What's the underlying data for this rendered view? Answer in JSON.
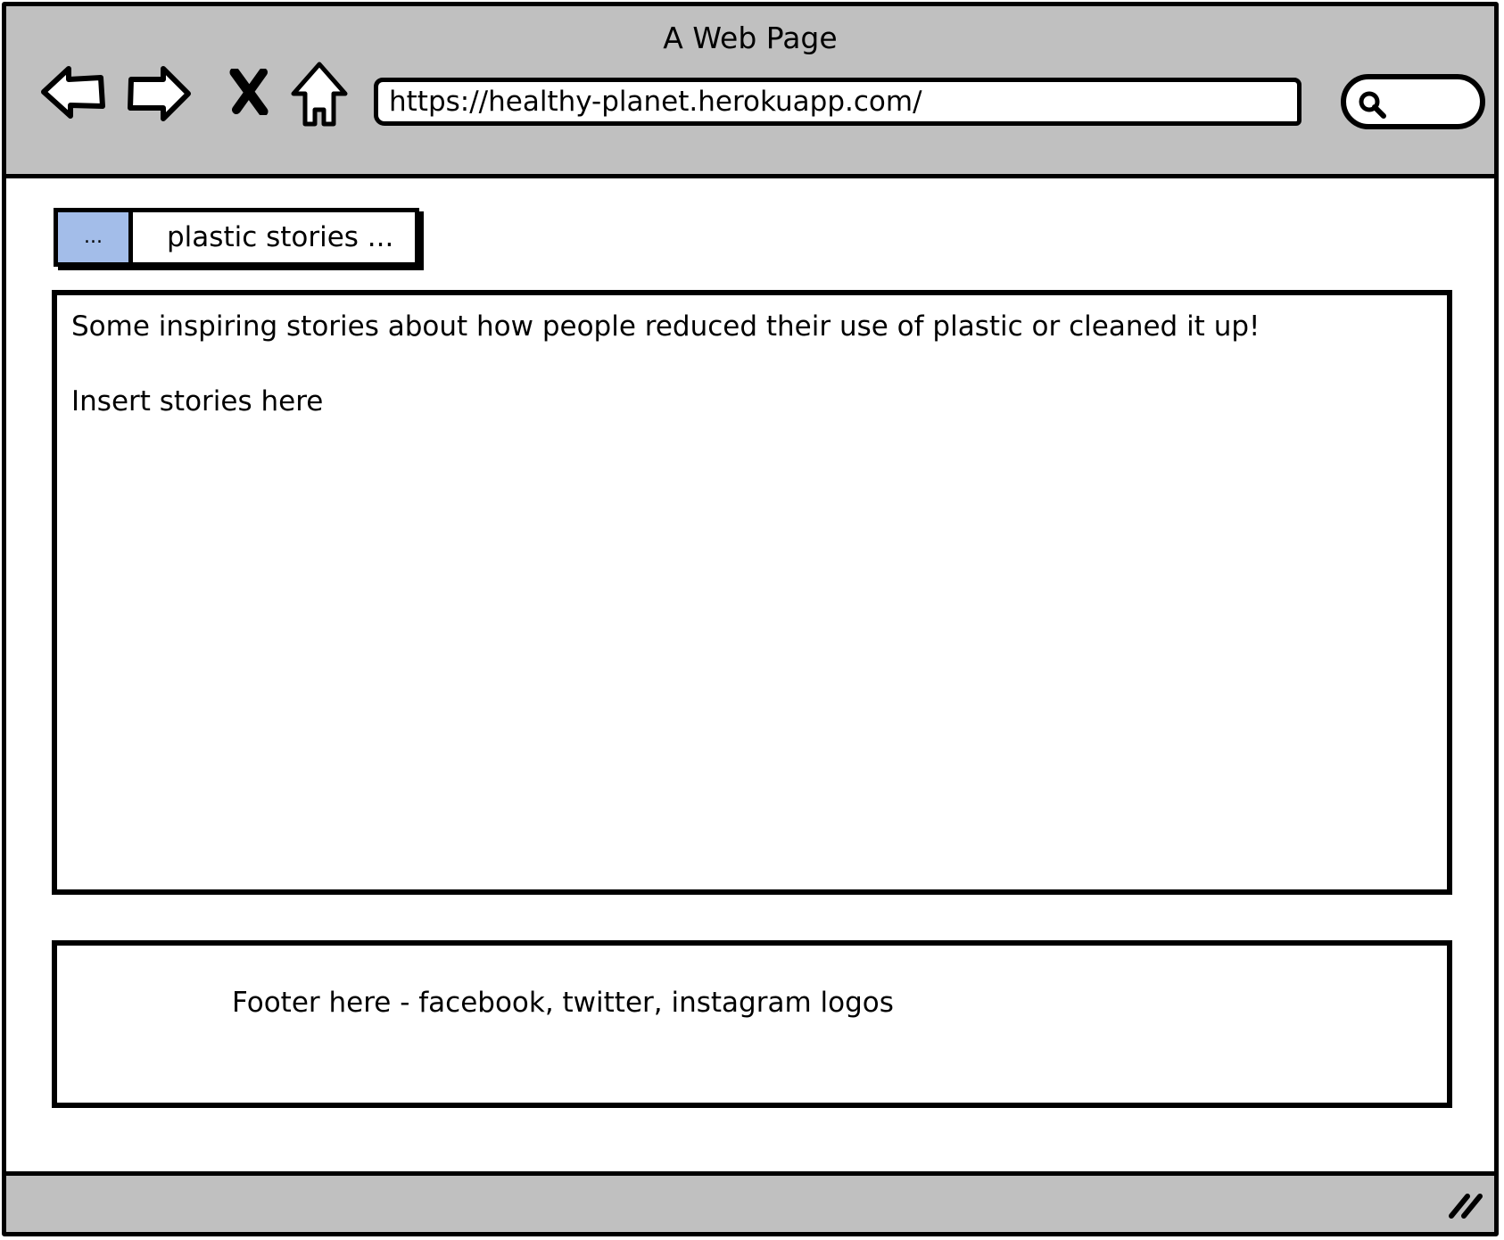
{
  "window": {
    "title": "A Web Page"
  },
  "toolbar": {
    "back_icon": "back-arrow-icon",
    "forward_icon": "forward-arrow-icon",
    "stop_icon": "close-icon",
    "home_icon": "home-icon",
    "url": "https://healthy-planet.herokuapp.com/",
    "search_icon": "search-icon"
  },
  "breadcrumb": {
    "items": [
      {
        "label": "..."
      },
      {
        "label": "plastic stories ..."
      }
    ]
  },
  "main": {
    "intro": "Some inspiring stories about how people reduced their use of plastic or cleaned it up!",
    "placeholder": "Insert stories here"
  },
  "footer": {
    "text": "Footer here - facebook, twitter, instagram logos"
  },
  "statusbar": {
    "resize_icon": "resize-grip-icon"
  },
  "colors": {
    "chrome_gray": "#c0c0c0",
    "breadcrumb_accent": "#a3bde9",
    "outline": "#000000",
    "page_background": "#ffffff"
  }
}
